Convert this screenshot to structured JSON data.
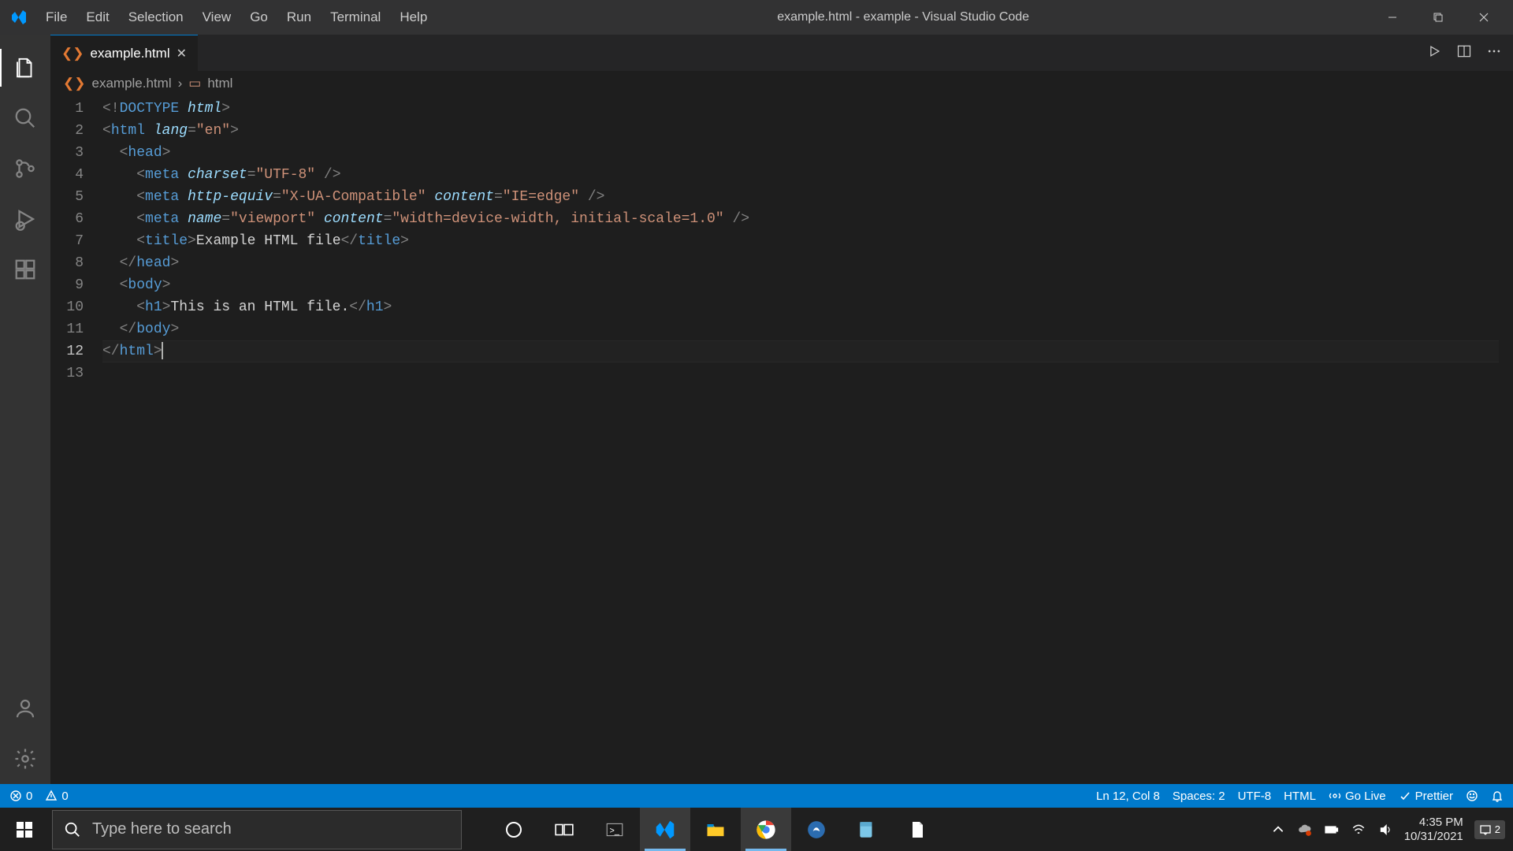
{
  "window": {
    "title": "example.html - example - Visual Studio Code"
  },
  "menu": [
    "File",
    "Edit",
    "Selection",
    "View",
    "Go",
    "Run",
    "Terminal",
    "Help"
  ],
  "tab": {
    "filename": "example.html"
  },
  "breadcrumb": {
    "file": "example.html",
    "symbol": "html"
  },
  "code": {
    "line_numbers": [
      "1",
      "2",
      "3",
      "4",
      "5",
      "6",
      "7",
      "8",
      "9",
      "10",
      "11",
      "12",
      "13"
    ],
    "current_line": 12,
    "lines": [
      [
        [
          "<!",
          "punct"
        ],
        [
          "DOCTYPE",
          "doctype"
        ],
        [
          " ",
          "text"
        ],
        [
          "html",
          "attr"
        ],
        [
          ">",
          "punct"
        ]
      ],
      [
        [
          "<",
          "punct"
        ],
        [
          "html",
          "tag"
        ],
        [
          " ",
          "text"
        ],
        [
          "lang",
          "attr"
        ],
        [
          "=",
          "punct"
        ],
        [
          "\"en\"",
          "str"
        ],
        [
          ">",
          "punct"
        ]
      ],
      [
        [
          "  ",
          "text"
        ],
        [
          "<",
          "punct"
        ],
        [
          "head",
          "tag"
        ],
        [
          ">",
          "punct"
        ]
      ],
      [
        [
          "    ",
          "text"
        ],
        [
          "<",
          "punct"
        ],
        [
          "meta",
          "tag"
        ],
        [
          " ",
          "text"
        ],
        [
          "charset",
          "attr"
        ],
        [
          "=",
          "punct"
        ],
        [
          "\"UTF-8\"",
          "str"
        ],
        [
          " />",
          "punct"
        ]
      ],
      [
        [
          "    ",
          "text"
        ],
        [
          "<",
          "punct"
        ],
        [
          "meta",
          "tag"
        ],
        [
          " ",
          "text"
        ],
        [
          "http-equiv",
          "attr"
        ],
        [
          "=",
          "punct"
        ],
        [
          "\"X-UA-Compatible\"",
          "str"
        ],
        [
          " ",
          "text"
        ],
        [
          "content",
          "attr"
        ],
        [
          "=",
          "punct"
        ],
        [
          "\"IE=edge\"",
          "str"
        ],
        [
          " />",
          "punct"
        ]
      ],
      [
        [
          "    ",
          "text"
        ],
        [
          "<",
          "punct"
        ],
        [
          "meta",
          "tag"
        ],
        [
          " ",
          "text"
        ],
        [
          "name",
          "attr"
        ],
        [
          "=",
          "punct"
        ],
        [
          "\"viewport\"",
          "str"
        ],
        [
          " ",
          "text"
        ],
        [
          "content",
          "attr"
        ],
        [
          "=",
          "punct"
        ],
        [
          "\"width=device-width, initial-scale=1.0\"",
          "str"
        ],
        [
          " />",
          "punct"
        ]
      ],
      [
        [
          "    ",
          "text"
        ],
        [
          "<",
          "punct"
        ],
        [
          "title",
          "tag"
        ],
        [
          ">",
          "punct"
        ],
        [
          "Example HTML file",
          "text"
        ],
        [
          "</",
          "punct"
        ],
        [
          "title",
          "tag"
        ],
        [
          ">",
          "punct"
        ]
      ],
      [
        [
          "  ",
          "text"
        ],
        [
          "</",
          "punct"
        ],
        [
          "head",
          "tag"
        ],
        [
          ">",
          "punct"
        ]
      ],
      [
        [
          "  ",
          "text"
        ],
        [
          "<",
          "punct"
        ],
        [
          "body",
          "tag"
        ],
        [
          ">",
          "punct"
        ]
      ],
      [
        [
          "    ",
          "text"
        ],
        [
          "<",
          "punct"
        ],
        [
          "h1",
          "tag"
        ],
        [
          ">",
          "punct"
        ],
        [
          "This is an HTML file.",
          "text"
        ],
        [
          "</",
          "punct"
        ],
        [
          "h1",
          "tag"
        ],
        [
          ">",
          "punct"
        ]
      ],
      [
        [
          "  ",
          "text"
        ],
        [
          "</",
          "punct"
        ],
        [
          "body",
          "tag"
        ],
        [
          ">",
          "punct"
        ]
      ],
      [
        [
          "</",
          "punct"
        ],
        [
          "html",
          "tag"
        ],
        [
          ">",
          "punct"
        ]
      ],
      [
        [
          "",
          "text"
        ]
      ]
    ]
  },
  "status": {
    "errors": "0",
    "warnings": "0",
    "cursor": "Ln 12, Col 8",
    "spaces": "Spaces: 2",
    "encoding": "UTF-8",
    "lang": "HTML",
    "golive": "Go Live",
    "prettier": "Prettier"
  },
  "taskbar": {
    "search_placeholder": "Type here to search",
    "time": "4:35 PM",
    "date": "10/31/2021",
    "notif_count": "2"
  }
}
